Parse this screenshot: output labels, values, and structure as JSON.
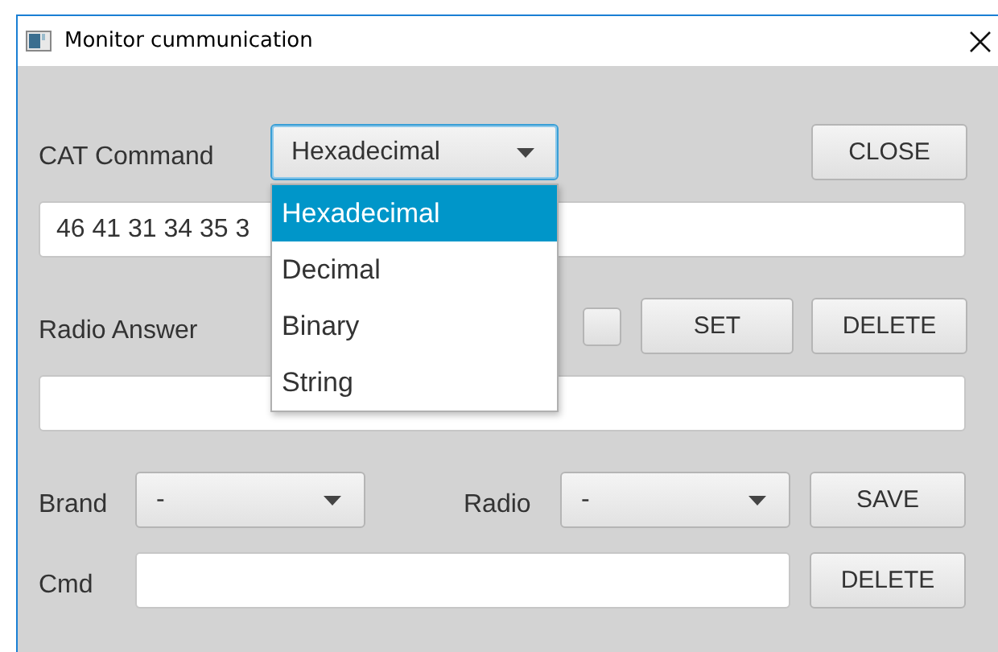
{
  "window": {
    "title": "Monitor cummunication"
  },
  "cat_command": {
    "label": "CAT Command",
    "format": {
      "value": "Hexadecimal",
      "expanded": true,
      "options": [
        {
          "label": "Hexadecimal",
          "selected": true
        },
        {
          "label": "Decimal",
          "selected": false
        },
        {
          "label": "Binary",
          "selected": false
        },
        {
          "label": "String",
          "selected": false
        }
      ]
    },
    "value": "46 41 31 34 35 3",
    "close_button": "CLOSE"
  },
  "radio_answer": {
    "label": "Radio Answer",
    "checked": false,
    "set_button": "SET",
    "delete_button": "DELETE"
  },
  "brand": {
    "label": "Brand",
    "value": "-"
  },
  "radio": {
    "label": "Radio",
    "value": "-"
  },
  "save_button": "SAVE",
  "cmd": {
    "label": "Cmd",
    "delete_button": "DELETE"
  }
}
